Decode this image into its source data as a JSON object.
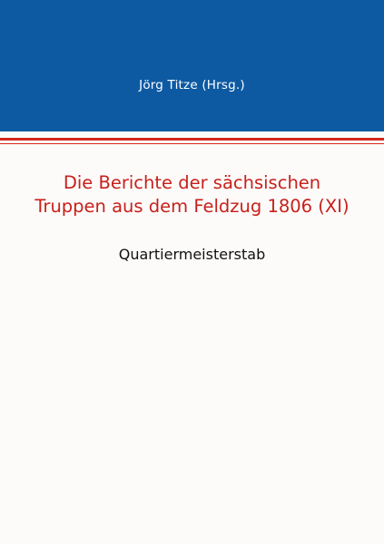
{
  "cover": {
    "author": "Jörg Titze (Hrsg.)",
    "title_line1": "Die Berichte der sächsischen",
    "title_line2": "Truppen aus dem Feldzug 1806 (XI)",
    "subtitle": "Quartiermeisterstab"
  },
  "colors": {
    "band": "#0d5aa3",
    "accent_red": "#d5261c",
    "title_red": "#c8201a",
    "background": "#fcfbfa"
  }
}
